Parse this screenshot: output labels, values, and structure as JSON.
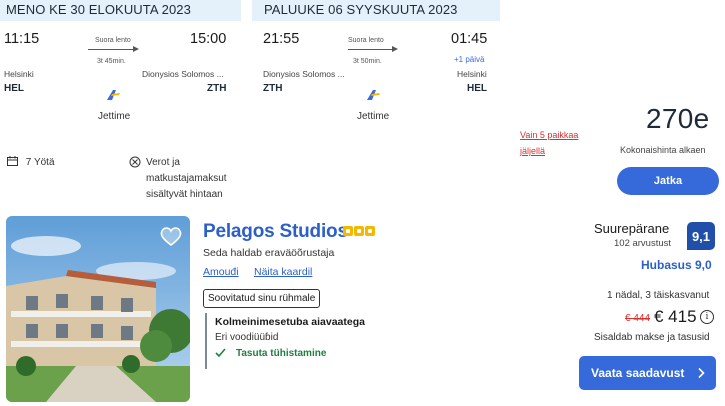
{
  "outbound": {
    "header": "MENO KE 30 ELOKUUTA 2023",
    "depart_time": "11:15",
    "arrive_time": "15:00",
    "direct_label": "Suora lento",
    "duration": "3t 45min.",
    "from_city": "Helsinki",
    "to_city": "Dionysios Solomos ...",
    "from_code": "HEL",
    "to_code": "ZTH",
    "airline": "Jettime"
  },
  "return": {
    "header": "PALUUKE 06 SYYSKUUTA 2023",
    "depart_time": "21:55",
    "arrive_time": "01:45",
    "direct_label": "Suora lento",
    "duration": "3t 50min.",
    "plus_day": "+1 päivä",
    "from_city": "Dionysios Solomos ...",
    "to_city": "Helsinki",
    "from_code": "ZTH",
    "to_code": "HEL",
    "airline": "Jettime"
  },
  "trip_info": {
    "nights": "7 Yötä",
    "taxes_line1": "Verot ja",
    "taxes_line2": "matkustajamaksut",
    "taxes_line3": "sisältyvät hintaan"
  },
  "package": {
    "seats_left_line1": "Vain 5 paikkaa",
    "seats_left_line2": "jäljellä",
    "price": "270e",
    "price_label": "Kokonaishinta alkaen",
    "continue_label": "Jatka"
  },
  "hotel": {
    "name": "Pelagos Studios",
    "operator": "Seda haldab eraväöõrustaja",
    "link_amenities": "Amouđi",
    "link_map": "Näita kaardil",
    "group_tag": "Soovitatud sinu rühmale",
    "room_type": "Kolmeinimesetuba aiavaatega",
    "beds": "Eri voodiüüɓid",
    "free_cancel": "Tasuta tühistamine",
    "rating_word": "Suurepärane",
    "reviews": "102 arvustust",
    "score": "9,1",
    "location_score": "Hubasus 9,0",
    "stay_info": "1 nädal, 3 täiskasvanut",
    "old_price": "€ 444",
    "new_price": "€ 415",
    "includes": "Sisaldab makse ja tasusid",
    "deal_button": "Vaata saadavust",
    "stars": 3
  },
  "colors": {
    "accent": "#3669d9",
    "link": "#2d5fc9",
    "header_bg": "#e4f1fb",
    "warning": "#d93030",
    "success": "#1f7f3f",
    "score_bg": "#1f4fa8",
    "star": "#f3b800"
  }
}
